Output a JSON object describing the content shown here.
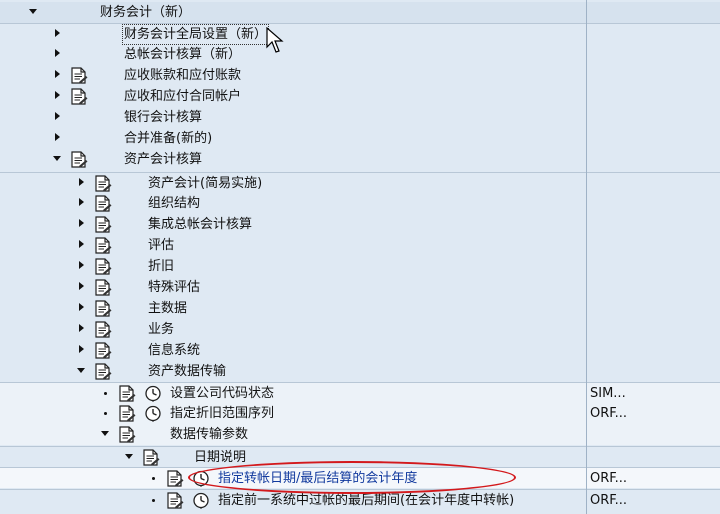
{
  "tree": {
    "root": {
      "label": "财务会计（新）"
    },
    "items": [
      {
        "label": "财务会计全局设置（新）"
      },
      {
        "label": "总帐会计核算（新）"
      },
      {
        "label": "应收账款和应付账款"
      },
      {
        "label": "应收和应付合同帐户"
      },
      {
        "label": "银行会计核算"
      },
      {
        "label": "合并准备(新的)"
      },
      {
        "label": "资产会计核算"
      },
      {
        "label": "资产会计(简易实施)"
      },
      {
        "label": "组织结构"
      },
      {
        "label": "集成总帐会计核算"
      },
      {
        "label": "评估"
      },
      {
        "label": "折旧"
      },
      {
        "label": "特殊评估"
      },
      {
        "label": "主数据"
      },
      {
        "label": "业务"
      },
      {
        "label": "信息系统"
      },
      {
        "label": "资产数据传输"
      },
      {
        "label": "设置公司代码状态",
        "code": "SIM..."
      },
      {
        "label": "指定折旧范围序列",
        "code": "ORF..."
      },
      {
        "label": "数据传输参数"
      },
      {
        "label": "日期说明"
      },
      {
        "label": "指定转帐日期/最后结算的会计年度",
        "code": "ORF..."
      },
      {
        "label": "指定前一系统中过帐的最后期间(在会计年度中转帐)",
        "code": "ORF..."
      }
    ]
  },
  "colors": {
    "highlight_oval": "#d3191c",
    "selected_text": "#123a9e",
    "background": "#dfe9f3"
  }
}
